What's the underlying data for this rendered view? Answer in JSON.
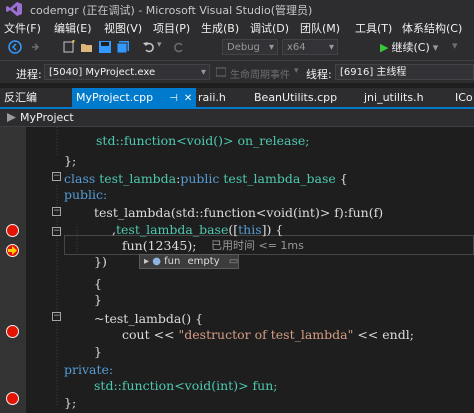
{
  "window": {
    "title": "codemgr (正在调试) - Microsoft Visual Studio(管理员)"
  },
  "menu": [
    "文件(F)",
    "编辑(E)",
    "视图(V)",
    "项目(P)",
    "生成(B)",
    "调试(D)",
    "团队(M)",
    "工具(T)",
    "体系结构(C)"
  ],
  "toolbar": {
    "config_dropdown": "Debug",
    "platform_dropdown": "x64",
    "continue_label": "继续(C)"
  },
  "debugbar": {
    "process_label": "进程:",
    "process_value": "[5040] MyProject.exe",
    "lifecycle_label": "生命周期事件",
    "thread_label": "线程:",
    "thread_value": "[6916] 主线程"
  },
  "tabs": [
    {
      "label": "反汇编",
      "active": false
    },
    {
      "label": "MyProject.cpp",
      "active": true
    },
    {
      "label": "raii.h",
      "active": false
    },
    {
      "label": "BeanUtilits.cpp",
      "active": false
    },
    {
      "label": "jni_utilits.h",
      "active": false
    },
    {
      "label": "ICo",
      "active": false
    }
  ],
  "nav": {
    "project": "MyProject"
  },
  "code": {
    "l1": "std::function<void()> on_release;",
    "l2": "};",
    "l3_kw1": "class",
    "l3_name": "test_lambda",
    "l3_colon": ":",
    "l3_kw2": "public",
    "l3_base": "test_lambda_base",
    "l3_end": "{",
    "l4": "public:",
    "l5": "test_lambda(std::function<void(int)> f):fun(f)",
    "l6_pre": ",",
    "l6_base": "test_lambda_base",
    "l6_mid": "([",
    "l6_kw": "this",
    "l6_end": "]) {",
    "l7_pre": "fun(",
    "l7_num": "12345",
    "l7_end": ");",
    "l8": "})",
    "l9": "{",
    "l10": "}",
    "l11": "~test_lambda() {",
    "l12_pre": "cout << ",
    "l12_str": "\"destructor of test_lambda\"",
    "l12_end": " << endl;",
    "l13": "}",
    "l14": "private:",
    "l15": "std::function<void(int)> fun;",
    "l16": "};"
  },
  "perftip": "已用时间 <= 1ms",
  "datatip": {
    "name": "fun",
    "value": "empty"
  },
  "colors": {
    "accent": "#007acc",
    "keyword": "#569cd6",
    "type": "#4ec9b0",
    "string": "#d69d85",
    "breakpoint": "#e51400"
  }
}
